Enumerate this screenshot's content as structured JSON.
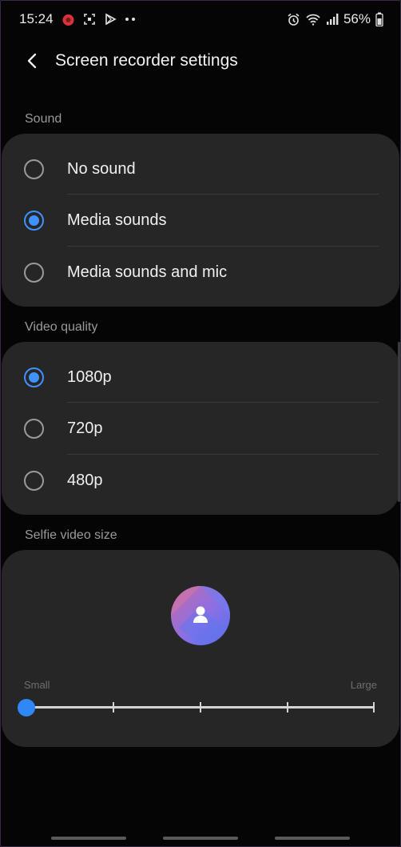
{
  "status_bar": {
    "time": "15:24",
    "battery_percent": "56%",
    "left_icons": [
      "app-notification-icon",
      "screenshot-icon",
      "play-store-icon",
      "more-notifications-icon"
    ],
    "right_icons": [
      "alarm-icon",
      "wifi-icon",
      "signal-icon",
      "battery-icon"
    ]
  },
  "header": {
    "title": "Screen recorder settings"
  },
  "sound": {
    "label": "Sound",
    "options": [
      {
        "label": "No sound",
        "selected": false
      },
      {
        "label": "Media sounds",
        "selected": true
      },
      {
        "label": "Media sounds and mic",
        "selected": false
      }
    ]
  },
  "video_quality": {
    "label": "Video quality",
    "options": [
      {
        "label": "1080p",
        "selected": true
      },
      {
        "label": "720p",
        "selected": false
      },
      {
        "label": "480p",
        "selected": false
      }
    ]
  },
  "selfie_size": {
    "label": "Selfie video size",
    "min_label": "Small",
    "max_label": "Large",
    "steps": 5,
    "value_step": 0
  },
  "colors": {
    "accent": "#3e91ff",
    "background": "#050505",
    "card": "#262626"
  }
}
